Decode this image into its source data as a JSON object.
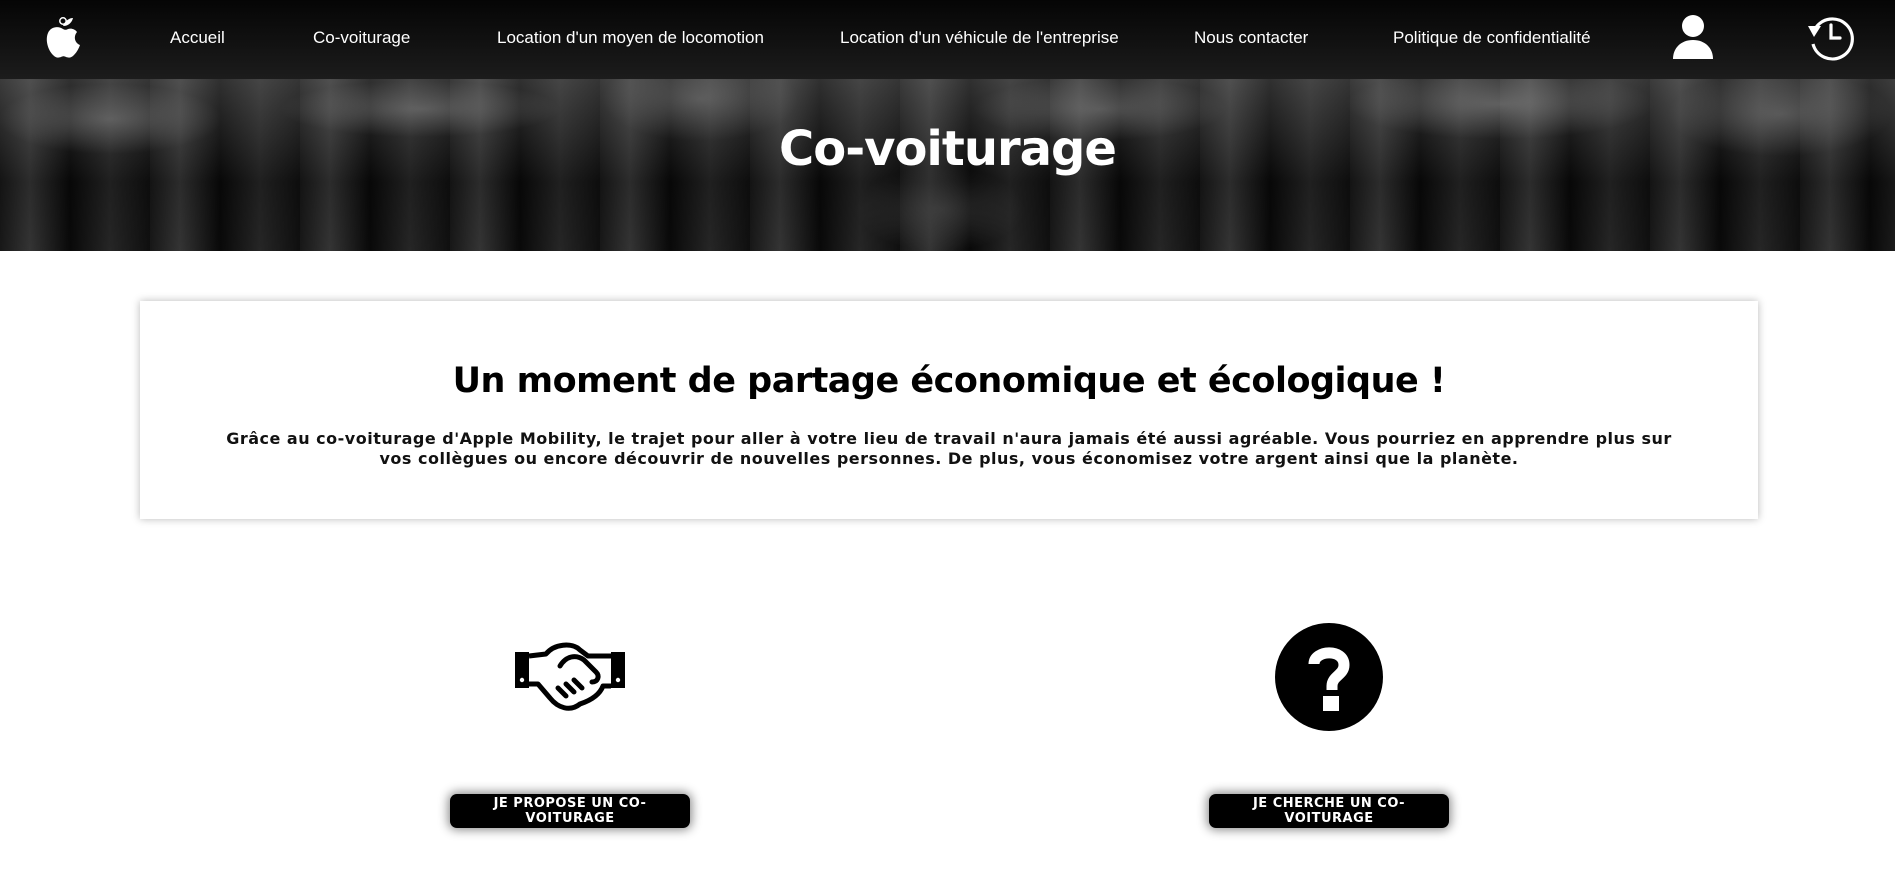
{
  "nav": {
    "items": [
      {
        "label": "Accueil"
      },
      {
        "label": "Co-voiturage"
      },
      {
        "label": "Location d'un moyen de locomotion"
      },
      {
        "label": "Location d'un véhicule de l'entreprise"
      },
      {
        "label": "Nous contacter"
      },
      {
        "label": "Politique de confidentialité"
      }
    ],
    "icons": {
      "logo": "apple-logo",
      "user": "user-icon",
      "history": "history-icon"
    }
  },
  "hero": {
    "title": "Co-voiturage"
  },
  "intro": {
    "heading": "Un moment de partage économique et écologique !",
    "text": "Grâce au co-voiturage d'Apple Mobility, le trajet pour aller à votre lieu de travail n'aura jamais été aussi agréable. Vous pourriez en apprendre plus sur vos collègues ou encore découvrir de nouvelles personnes. De plus, vous économisez votre argent ainsi que la planète."
  },
  "actions": {
    "propose": {
      "icon": "handshake-icon",
      "label": "JE PROPOSE UN CO-VOITURAGE"
    },
    "cherche": {
      "icon": "question-circle-icon",
      "label": "JE CHERCHE UN CO-VOITURAGE"
    }
  },
  "colors": {
    "nav_bg": "#0d0d0d",
    "text": "#000000",
    "button_bg": "#000000",
    "button_text": "#ffffff"
  }
}
